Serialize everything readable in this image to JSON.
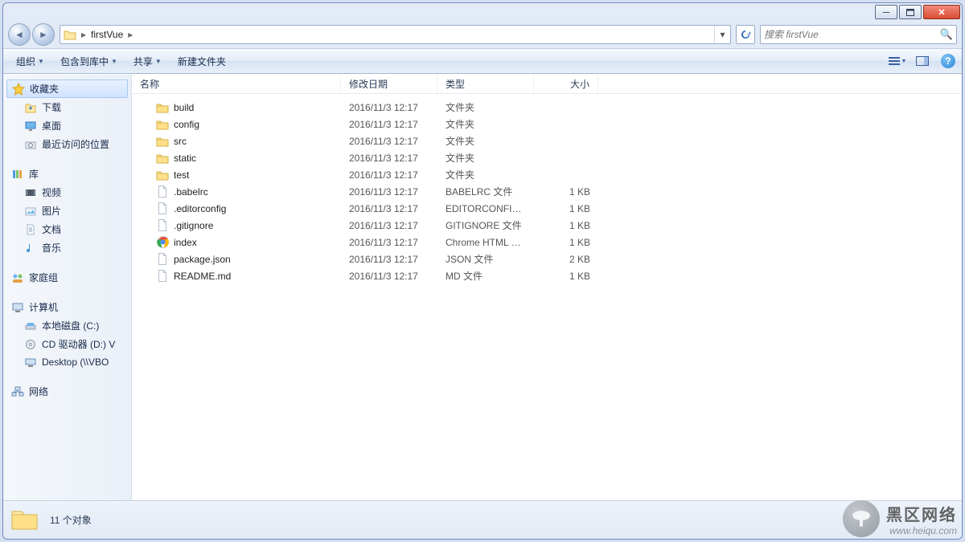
{
  "path": {
    "crumb": "firstVue"
  },
  "search": {
    "placeholder": "搜索 firstVue"
  },
  "toolbar": {
    "organize": "组织",
    "include": "包含到库中",
    "share": "共享",
    "newfolder": "新建文件夹"
  },
  "columns": {
    "name": "名称",
    "date": "修改日期",
    "type": "类型",
    "size": "大小"
  },
  "sidebar": {
    "favorites": "收藏夹",
    "downloads": "下载",
    "desktop": "桌面",
    "recent": "最近访问的位置",
    "libraries": "库",
    "videos": "视频",
    "pictures": "图片",
    "documents": "文档",
    "music": "音乐",
    "homegroup": "家庭组",
    "computer": "计算机",
    "localc": "本地磁盘 (C:)",
    "cddrive": "CD 驱动器 (D:) V",
    "desktopnet": "Desktop (\\\\VBO",
    "network": "网络"
  },
  "files": [
    {
      "icon": "folder",
      "name": "build",
      "date": "2016/11/3 12:17",
      "type": "文件夹",
      "size": ""
    },
    {
      "icon": "folder",
      "name": "config",
      "date": "2016/11/3 12:17",
      "type": "文件夹",
      "size": ""
    },
    {
      "icon": "folder",
      "name": "src",
      "date": "2016/11/3 12:17",
      "type": "文件夹",
      "size": ""
    },
    {
      "icon": "folder",
      "name": "static",
      "date": "2016/11/3 12:17",
      "type": "文件夹",
      "size": ""
    },
    {
      "icon": "folder",
      "name": "test",
      "date": "2016/11/3 12:17",
      "type": "文件夹",
      "size": ""
    },
    {
      "icon": "file",
      "name": ".babelrc",
      "date": "2016/11/3 12:17",
      "type": "BABELRC 文件",
      "size": "1 KB"
    },
    {
      "icon": "file",
      "name": ".editorconfig",
      "date": "2016/11/3 12:17",
      "type": "EDITORCONFIG ...",
      "size": "1 KB"
    },
    {
      "icon": "file",
      "name": ".gitignore",
      "date": "2016/11/3 12:17",
      "type": "GITIGNORE 文件",
      "size": "1 KB"
    },
    {
      "icon": "chrome",
      "name": "index",
      "date": "2016/11/3 12:17",
      "type": "Chrome HTML D...",
      "size": "1 KB"
    },
    {
      "icon": "file",
      "name": "package.json",
      "date": "2016/11/3 12:17",
      "type": "JSON 文件",
      "size": "2 KB"
    },
    {
      "icon": "file",
      "name": "README.md",
      "date": "2016/11/3 12:17",
      "type": "MD 文件",
      "size": "1 KB"
    }
  ],
  "status": {
    "count": "11 个对象"
  },
  "watermark": {
    "title": "黑区网络",
    "url": "www.heiqu.com"
  }
}
